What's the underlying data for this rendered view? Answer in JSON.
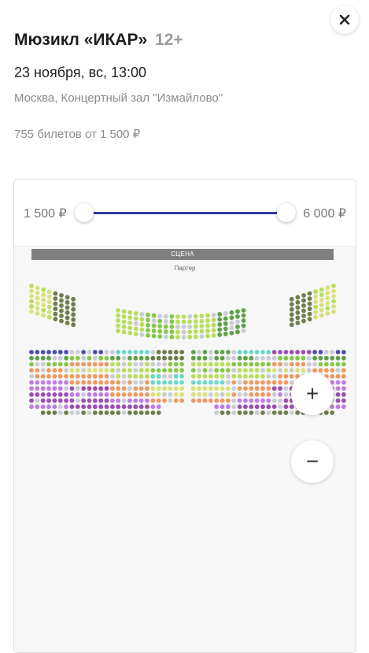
{
  "event": {
    "title": "Мюзикл «ИКАР»",
    "age": "12+",
    "date": "23 ноября, вс, 13:00",
    "venue": "Москва, Концертный зал \"Измайлово\"",
    "tickets": "755 билетов от 1 500 ₽"
  },
  "price_filter": {
    "min": "1 500 ₽",
    "max": "6 000 ₽"
  },
  "hall": {
    "stage": "СЦЕНА",
    "section": "Партер"
  },
  "controls": {
    "zoom_in": "+",
    "zoom_out": "−"
  },
  "icons": [
    "close-icon",
    "plus-icon",
    "minus-icon"
  ],
  "colors": {
    "accent": "#2f3d9e",
    "seat_unavailable": "#c9ccd6",
    "seat_palette": [
      "#d9e27a",
      "#b8de5c",
      "#86c84a",
      "#5fa04a",
      "#6f7d4c",
      "#68d9c8",
      "#ed9a63",
      "#c07de0",
      "#9d4fb0",
      "#4b4fa8"
    ]
  }
}
